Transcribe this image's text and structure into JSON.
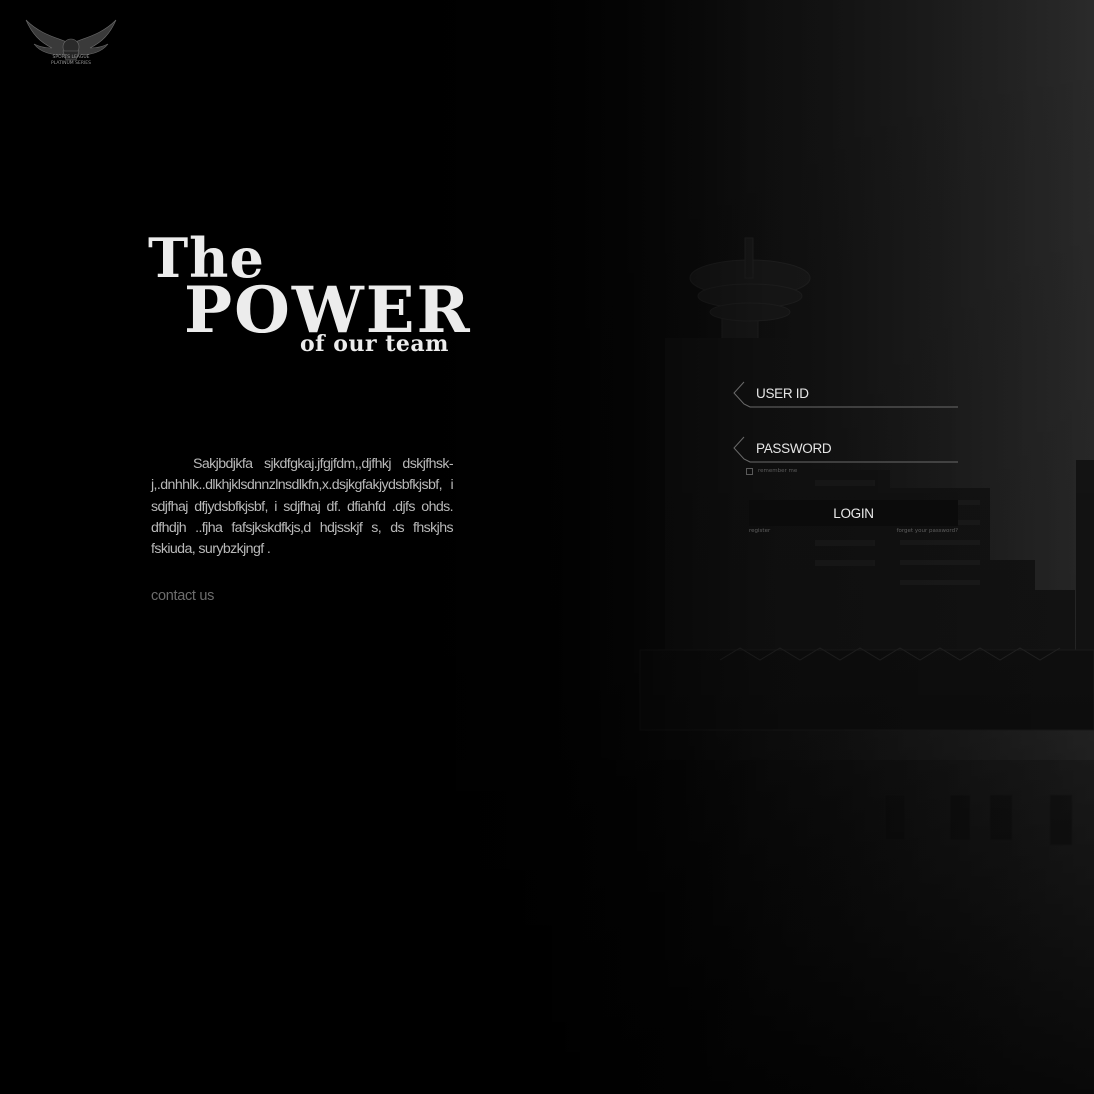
{
  "brand": {
    "logo_text_top": "SPORTS LEAGUE",
    "logo_text_bottom": "PLATINUM SERIES"
  },
  "hero": {
    "title_line1": "The",
    "title_line2": "POWER",
    "title_line3": "of our team",
    "body": "Sakjbdjkfa sjkdfgkaj.jfgjfdm,,djfhkj  dskjfhsk-j,.dnhhlk..dlkhjklsdnnzlnsdlkfn,x.dsjkgfakjydsbfkjsbf, i sdjfhaj dfjydsbfkjsbf, i sdjfhaj df. dfiahfd .djfs ohds. dfhdjh ..fjha fafsjkskdfkjs,d hdjsskjf  s, ds fhskjhs fskiuda, surybzkjngf  .",
    "contact_link": "contact us"
  },
  "login": {
    "user_id_placeholder": "USER ID",
    "password_placeholder": "PASSWORD",
    "remember_label": "remember me",
    "login_button": "LOGIN",
    "register_link": "register",
    "forgot_link": "forget your password?"
  },
  "colors": {
    "background": "#000000",
    "text_primary": "#ececec",
    "text_muted": "#6d6d6d",
    "button_bg": "#0b0b0b"
  }
}
